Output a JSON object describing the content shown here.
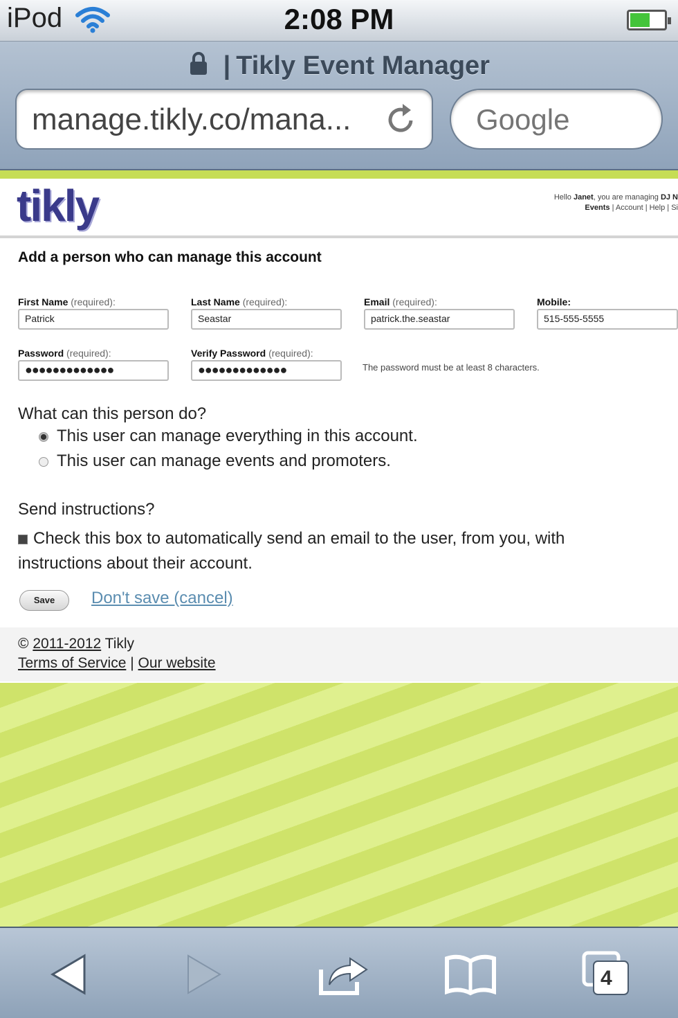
{
  "status_bar": {
    "carrier": "iPod",
    "time": "2:08 PM"
  },
  "browser": {
    "page_title": "Tikly Event Manager",
    "url": "manage.tikly.co/mana...",
    "search_placeholder": "Google",
    "tabs_count": "4"
  },
  "header": {
    "logo": "tikly",
    "hello_prefix": "Hello",
    "user_name": "Janet",
    "managing_text": ", you are managing",
    "managing_name": "DJ N",
    "nav": {
      "events": "Events",
      "sep1": "|",
      "account": "Account",
      "sep2": "|",
      "help": "Help",
      "sep3": "|",
      "more": "Si"
    }
  },
  "form": {
    "title": "Add a person who can manage this account",
    "first_name": {
      "label": "First Name",
      "req": "(required):",
      "value": "Patrick"
    },
    "last_name": {
      "label": "Last Name",
      "req": "(required):",
      "value": "Seastar"
    },
    "email": {
      "label": "Email",
      "req": "(required):",
      "value": "patrick.the.seastar"
    },
    "mobile": {
      "label": "Mobile:",
      "value": "515-555-5555"
    },
    "password": {
      "label": "Password",
      "req": "(required):",
      "value": "●●●●●●●●●●●●●"
    },
    "verify_password": {
      "label": "Verify Password",
      "req": "(required):",
      "value": "●●●●●●●●●●●●●"
    },
    "password_hint": "The password must be at least 8 characters.",
    "question": "What can this person do?",
    "option_all": "This user can manage everything in this account.",
    "option_events": "This user can manage events and promoters.",
    "send_question": "Send instructions?",
    "send_check_line1": "Check this box to automatically send an email to the user, from you, with",
    "send_check_line2": "instructions about their account.",
    "save_label": "Save",
    "cancel_label": "Don't save (cancel)"
  },
  "footer": {
    "copyright_symbol": "©",
    "years": "2011-2012",
    "company": "Tikly",
    "terms": "Terms of Service",
    "sep": "|",
    "website": "Our website"
  },
  "icons": [
    "wifi-icon",
    "battery-icon",
    "lock-icon",
    "reload-icon",
    "back-icon",
    "forward-icon",
    "share-icon",
    "bookmarks-icon",
    "tabs-icon"
  ],
  "colors": {
    "accent_green": "#cfe36a",
    "link_blue": "#5b8db0",
    "logo_purple": "#3a3a8a"
  }
}
